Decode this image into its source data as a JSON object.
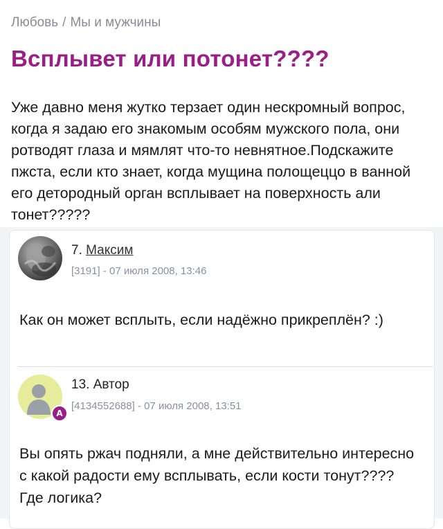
{
  "breadcrumb": {
    "section": "Любовь",
    "separator": "/",
    "subsection": "Мы и мужчины"
  },
  "title": "Всплывет или потонет????",
  "question": "Уже давно меня жутко терзает один нескромный вопрос, когда я задаю его знакомым особям мужского пола, они ротводят глаза и мямлят что-то невнятное.Подскажите пжста, если кто знает, когда мущина полощеццо в ванной его детородный орган всплывает на поверхность али тонет?????",
  "comments": [
    {
      "number": "7.",
      "author": "Максим",
      "meta": "[3191] - 07 июля 2008, 13:46",
      "text": "Как он может всплыть, если надёжно прикреплён? :)",
      "avatar_icon": "user-photo-icon"
    },
    {
      "number": "13.",
      "author": "Автор",
      "meta": "[4134552688] - 07 июля 2008, 13:51",
      "badge": "A",
      "text": "Вы опять ржач подняли, а мне действительно интересно с какой радости ему всплывать, если кости тонут???? Где логика?",
      "avatar_icon": "user-silhouette-icon"
    }
  ],
  "colors": {
    "title": "#9b1d86",
    "meta": "#8a8fa3",
    "breadcrumb": "#8a8a99",
    "author_avatar_bg": "#e6ec9a"
  }
}
